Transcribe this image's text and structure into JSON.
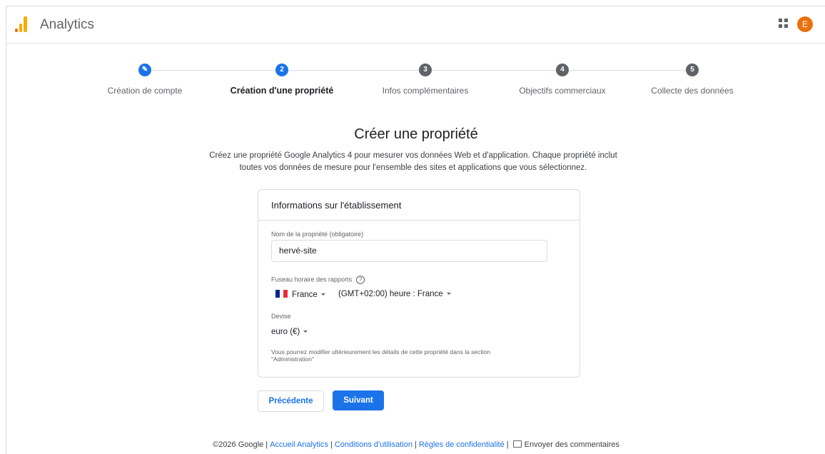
{
  "header": {
    "title": "Analytics",
    "avatar_initial": "E",
    "avatar_color": "#e8710a",
    "logo_colors": [
      "#f9ab00",
      "#e37400"
    ]
  },
  "stepper": {
    "active_color": "#1a73e8",
    "inactive_color": "#5f6368",
    "steps": [
      {
        "number": "✎",
        "label": "Création de compte",
        "state": "done"
      },
      {
        "number": "2",
        "label": "Création d'une propriété",
        "state": "active"
      },
      {
        "number": "3",
        "label": "Infos complémentaires",
        "state": "pending"
      },
      {
        "number": "4",
        "label": "Objectifs commerciaux",
        "state": "pending"
      },
      {
        "number": "5",
        "label": "Collecte des données",
        "state": "pending"
      }
    ]
  },
  "main": {
    "title": "Créer une propriété",
    "description_line1": "Créez une propriété Google Analytics 4 pour mesurer vos données Web et d'application. Chaque propriété inclut",
    "description_line2": "toutes vos données de mesure pour l'ensemble des sites et applications que vous sélectionnez."
  },
  "card": {
    "title": "Informations sur l'établissement",
    "property_name_label": "Nom de la propriété (obligatoire)",
    "property_name_value": "hervé-site",
    "timezone_label": "Fuseau horaire des rapports",
    "help_icon": "?",
    "country": "France",
    "timezone": "(GMT+02:00) heure : France",
    "currency_label": "Devise",
    "currency": "euro (€)",
    "note_line1": "Vous pourrez modifier ultérieurement les détails de cette propriété dans la section",
    "note_line2": "\"Administration\""
  },
  "buttons": {
    "previous": "Précédente",
    "next": "Suivant"
  },
  "footer": {
    "copyright": "©2026 Google",
    "home_link": "Accueil Analytics",
    "terms_link": "Conditions d'utilisation",
    "privacy_link": "Règles de confidentialité",
    "feedback": "Envoyer des commentaires"
  }
}
